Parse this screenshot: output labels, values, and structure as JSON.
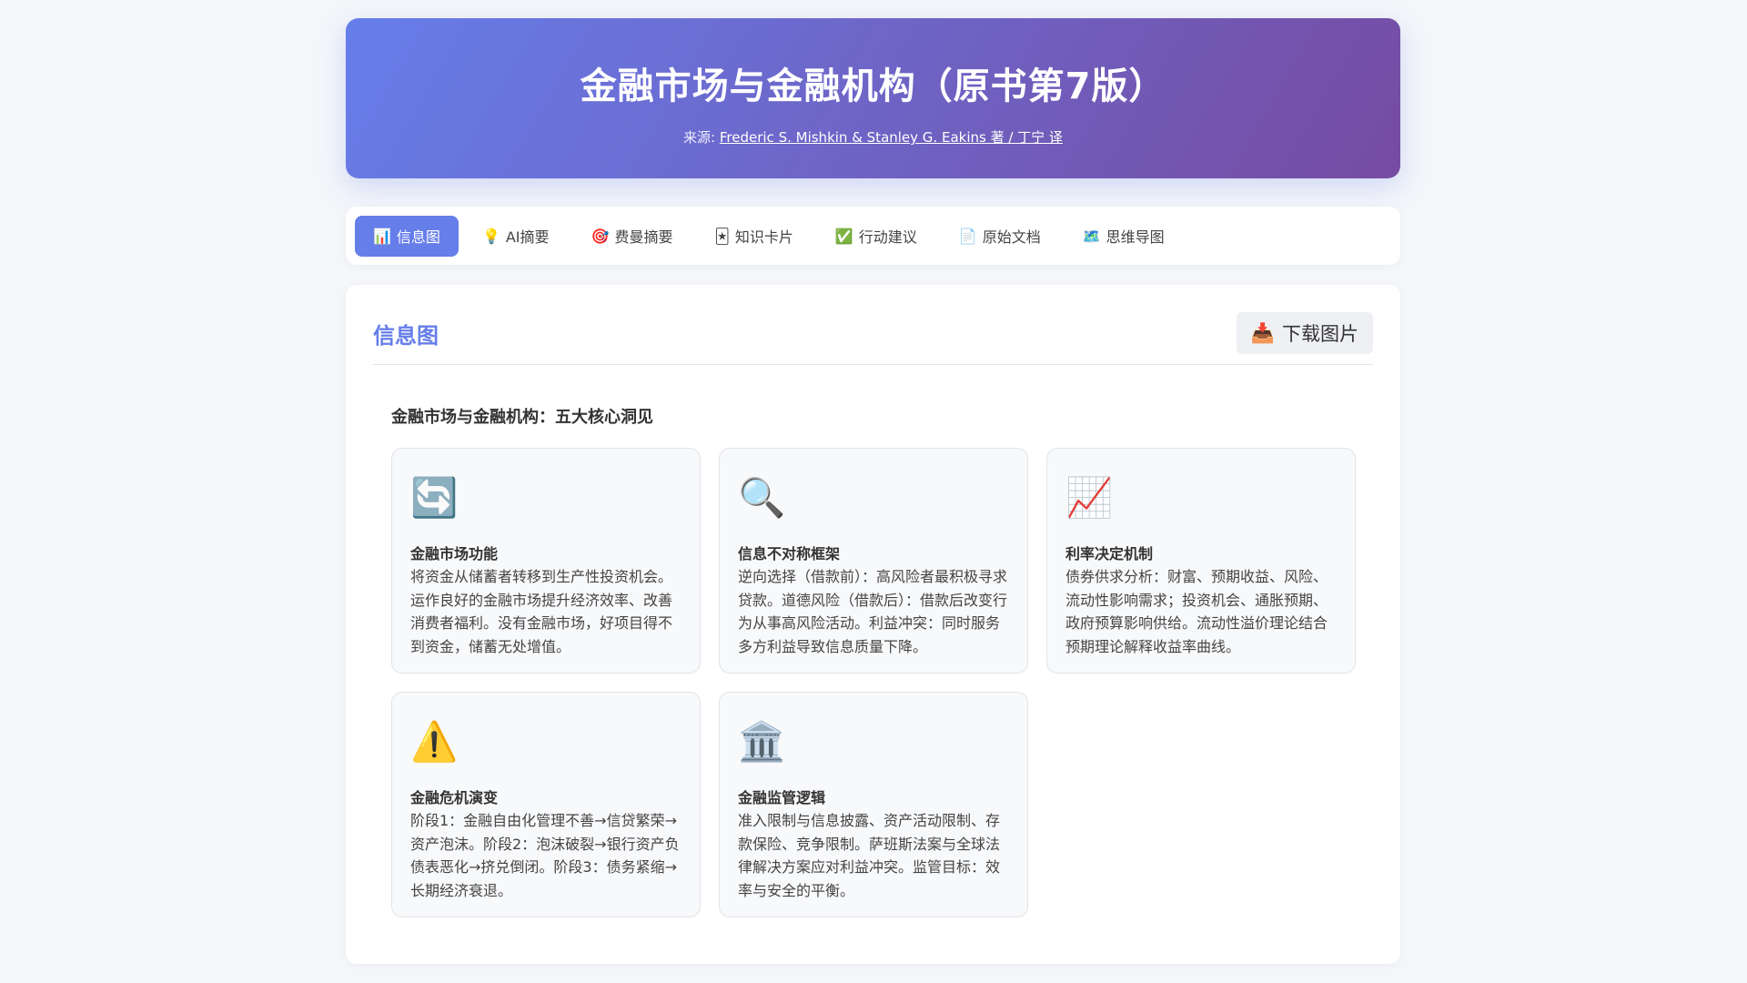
{
  "header": {
    "title": "金融市场与金融机构（原书第7版）",
    "source_label": "来源: ",
    "source_link": "Frederic S. Mishkin & Stanley G. Eakins 著 / 丁宁 译"
  },
  "nav": {
    "tabs": [
      {
        "icon": "📊",
        "label": "信息图"
      },
      {
        "icon": "💡",
        "label": "AI摘要"
      },
      {
        "icon": "🎯",
        "label": "费曼摘要"
      },
      {
        "icon": "🃏",
        "label": "知识卡片"
      },
      {
        "icon": "✅",
        "label": "行动建议"
      },
      {
        "icon": "📄",
        "label": "原始文档"
      },
      {
        "icon": "🗺️",
        "label": "思维导图"
      }
    ]
  },
  "main": {
    "title": "信息图",
    "download_icon": "📥",
    "download_label": "下载图片",
    "subtitle": "金融市场与金融机构：五大核心洞见",
    "cards": [
      {
        "icon": "🔄",
        "title": "金融市场功能",
        "body": "将资金从储蓄者转移到生产性投资机会。运作良好的金融市场提升经济效率、改善消费者福利。没有金融市场，好项目得不到资金，储蓄无处增值。"
      },
      {
        "icon": "🔍",
        "title": "信息不对称框架",
        "body": "逆向选择（借款前）：高风险者最积极寻求贷款。道德风险（借款后）：借款后改变行为从事高风险活动。利益冲突：同时服务多方利益导致信息质量下降。"
      },
      {
        "icon": "📈",
        "title": "利率决定机制",
        "body": "债券供求分析：财富、预期收益、风险、流动性影响需求；投资机会、通胀预期、政府预算影响供给。流动性溢价理论结合预期理论解释收益率曲线。"
      },
      {
        "icon": "⚠️",
        "title": "金融危机演变",
        "body": "阶段1：金融自由化管理不善→信贷繁荣→资产泡沫。阶段2：泡沫破裂→银行资产负债表恶化→挤兑倒闭。阶段3：债务紧缩→长期经济衰退。"
      },
      {
        "icon": "🏛️",
        "title": "金融监管逻辑",
        "body": "准入限制与信息披露、资产活动限制、存款保险、竞争限制。萨班斯法案与全球法律解决方案应对利益冲突。监管目标：效率与安全的平衡。"
      }
    ]
  }
}
